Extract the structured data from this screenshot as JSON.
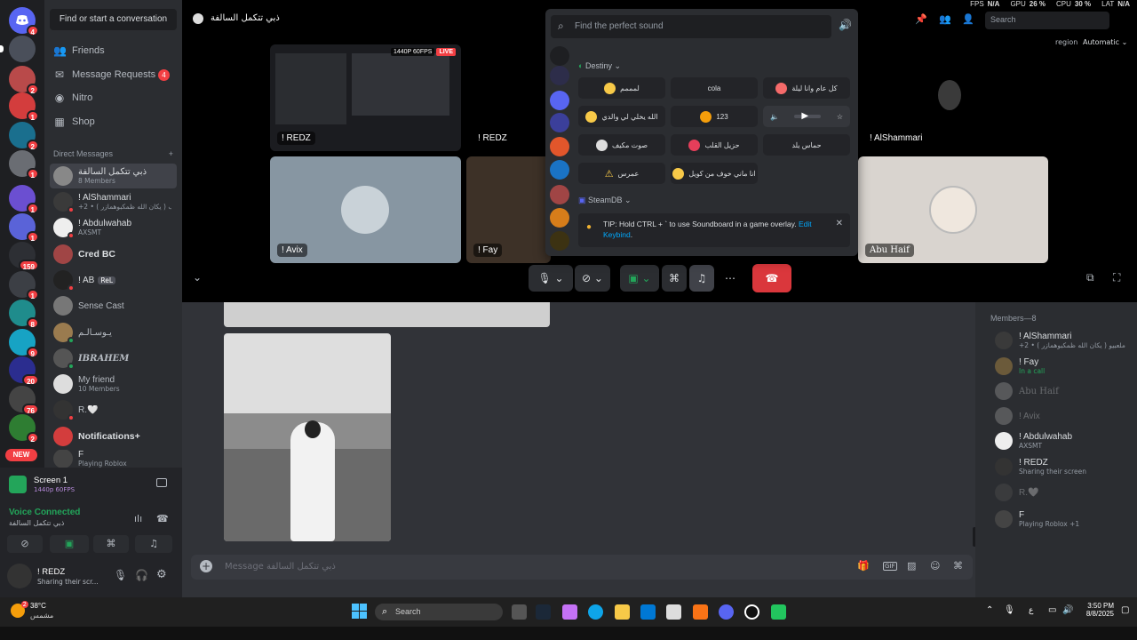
{
  "sidebar": {
    "search_label": "Find or start a conversation",
    "nav": [
      {
        "label": "Friends"
      },
      {
        "label": "Message Requests",
        "count": "4"
      },
      {
        "label": "Nitro"
      },
      {
        "label": "Shop"
      }
    ],
    "dm_header": "Direct Messages",
    "dm_add": "+",
    "dms": [
      {
        "name": "ذبي تتكمل السالفة",
        "sub": "8 Members"
      },
      {
        "name": "! AlShammari",
        "sub": "+2 • ( يكان الله ظمكبوهمازر ) ملعبيو ليكافيف"
      },
      {
        "name": "! Abdulwahab",
        "sub": "AXSMT"
      },
      {
        "name": "Cred BC",
        "sub": ""
      },
      {
        "name": "! AB",
        "sub": "ReL"
      },
      {
        "name": "Sense Cast",
        "sub": ""
      },
      {
        "name": "يـوسـالـم",
        "sub": ""
      },
      {
        "name": "IBRAHEM",
        "sub": ""
      },
      {
        "name": "My friend",
        "sub": "10 Members"
      },
      {
        "name": "R.🤍",
        "sub": ""
      },
      {
        "name": "Notifications+",
        "sub": ""
      },
      {
        "name": "F",
        "sub": "Playing Roblox"
      }
    ],
    "new_badge": "NEW"
  },
  "servers": [
    {
      "badge": "4"
    },
    {
      "badge": ""
    },
    {
      "badge": "2"
    },
    {
      "badge": "1"
    },
    {
      "badge": "2"
    },
    {
      "badge": "1"
    },
    {
      "badge": "1"
    },
    {
      "badge": "1"
    },
    {
      "badge": "159"
    },
    {
      "badge": "1"
    },
    {
      "badge": "8"
    },
    {
      "badge": "9"
    },
    {
      "badge": "20"
    },
    {
      "badge": "76"
    },
    {
      "badge": "2"
    },
    {
      "badge": "6"
    }
  ],
  "panel": {
    "stream_title": "Screen 1",
    "stream_quality": "1440p 60FPS",
    "voice_status": "Voice Connected",
    "voice_channel": "ذبي تتكمل السالفة",
    "username": "! REDZ",
    "user_status": "Sharing their scr..."
  },
  "header": {
    "channel": "ذبي تتكمل السالفة",
    "search_placeholder": "Search",
    "region_label": "region",
    "region_value": "Automatic"
  },
  "overlay": {
    "fps": "FPS",
    "fps_val": "N/A",
    "gpu": "GPU",
    "gpu_val": "26 %",
    "cpu": "CPU",
    "cpu_val": "30 %",
    "lat": "LAT",
    "lat_val": "N/A"
  },
  "stage": {
    "tiles": [
      {
        "label": "! REDZ",
        "badge_quality": "1440P 60FPS",
        "badge_live": "LIVE"
      },
      {
        "label": "! REDZ"
      },
      {
        "label": "! AlShammari"
      },
      {
        "label": "! Avix"
      },
      {
        "label": "! Fay"
      },
      {
        "label": "Abu Haif"
      }
    ]
  },
  "soundboard": {
    "search_placeholder": "Find the perfect sound",
    "section1": "Destiny",
    "sounds": [
      {
        "label": "لمممم"
      },
      {
        "label": "cola"
      },
      {
        "label": "كل عام وانا ليلة"
      },
      {
        "label": "الله يخلي لي والدي"
      },
      {
        "label": "123"
      },
      {
        "label": ""
      },
      {
        "label": "صوت مكيف"
      },
      {
        "label": "حزيل القلب"
      },
      {
        "label": "حماس يلد"
      },
      {
        "label": "عمرس"
      },
      {
        "label": "انا ماني خوف من كويل"
      }
    ],
    "section2": "SteamDB",
    "tip_prefix": "TIP: Hold CTRL + ` to use Soundboard in a game overlay.",
    "tip_link": "Edit Keybind",
    "tip_suffix": "."
  },
  "chat": {
    "input_placeholder": "Message ذبي تتكمل السالفة"
  },
  "members": {
    "header": "Members—8",
    "list": [
      {
        "name": "! AlShammari",
        "sub": "+2 • ( يكان الله ظمكبوهمازر ) ملعبيو"
      },
      {
        "name": "! Fay",
        "sub": "In a call"
      },
      {
        "name": "Abu Haif",
        "sub": ""
      },
      {
        "name": "! Avix",
        "sub": ""
      },
      {
        "name": "! Abdulwahab",
        "sub": "AXSMT"
      },
      {
        "name": "! REDZ",
        "sub": "Sharing their screen"
      },
      {
        "name": "R.🤍",
        "sub": ""
      },
      {
        "name": "F",
        "sub": "Playing Roblox +1"
      }
    ]
  },
  "taskbar": {
    "weather_temp": "38°C",
    "weather_desc": "مشمس",
    "weather_badge": "2",
    "search": "Search",
    "lang": "ع",
    "time": "3:50 PM",
    "date": "8/8/2025"
  }
}
